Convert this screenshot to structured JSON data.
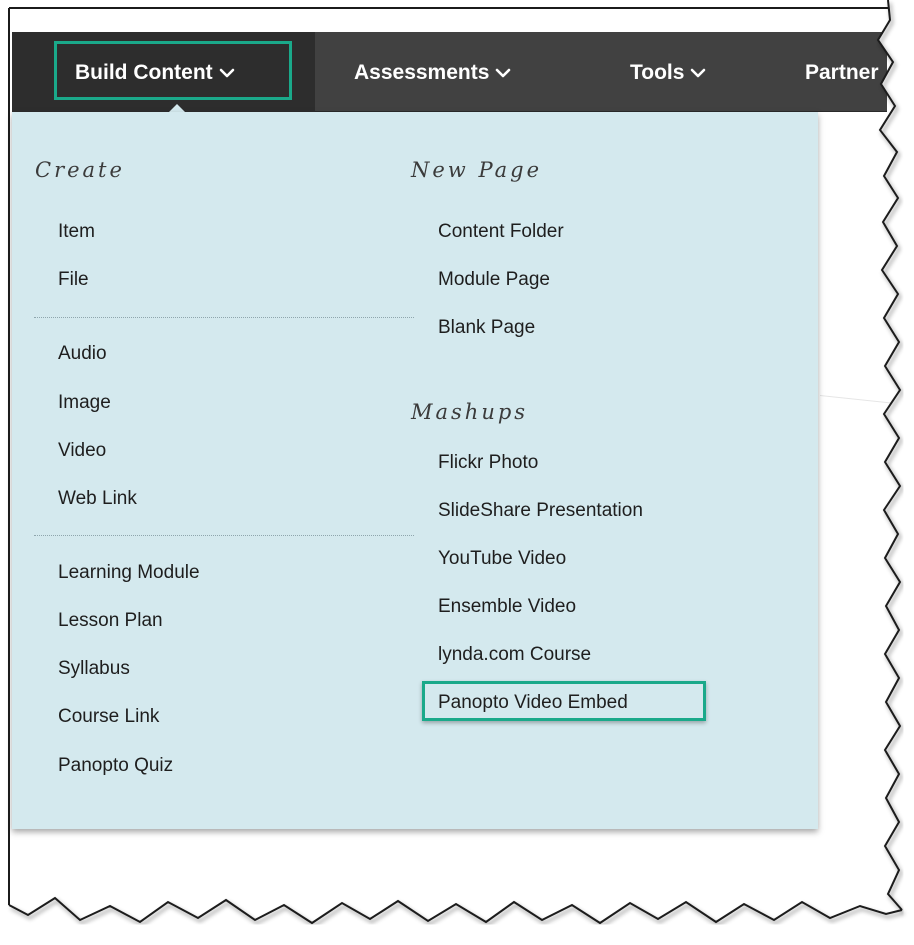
{
  "nav": {
    "items": [
      {
        "label": "Build Content",
        "active": true
      },
      {
        "label": "Assessments"
      },
      {
        "label": "Tools"
      },
      {
        "label": "Partner"
      }
    ],
    "highlight_color": "#1aa98a"
  },
  "dropdown": {
    "create": {
      "heading": "Create",
      "group1": [
        "Item",
        "File"
      ],
      "group2": [
        "Audio",
        "Image",
        "Video",
        "Web Link"
      ],
      "group3": [
        "Learning Module",
        "Lesson Plan",
        "Syllabus",
        "Course Link",
        "Panopto Quiz"
      ]
    },
    "new_page": {
      "heading": "New Page",
      "items": [
        "Content Folder",
        "Module Page",
        "Blank Page"
      ]
    },
    "mashups": {
      "heading": "Mashups",
      "items": [
        "Flickr Photo",
        "SlideShare Presentation",
        "YouTube Video",
        "Ensemble Video",
        "lynda.com Course",
        "Panopto Video Embed"
      ]
    },
    "highlighted_item": "Panopto Video Embed"
  },
  "colors": {
    "topbar": "#414141",
    "active_tab": "#2d2d2d",
    "dropdown_bg": "#d4e9ee",
    "highlight": "#1aa98a"
  }
}
